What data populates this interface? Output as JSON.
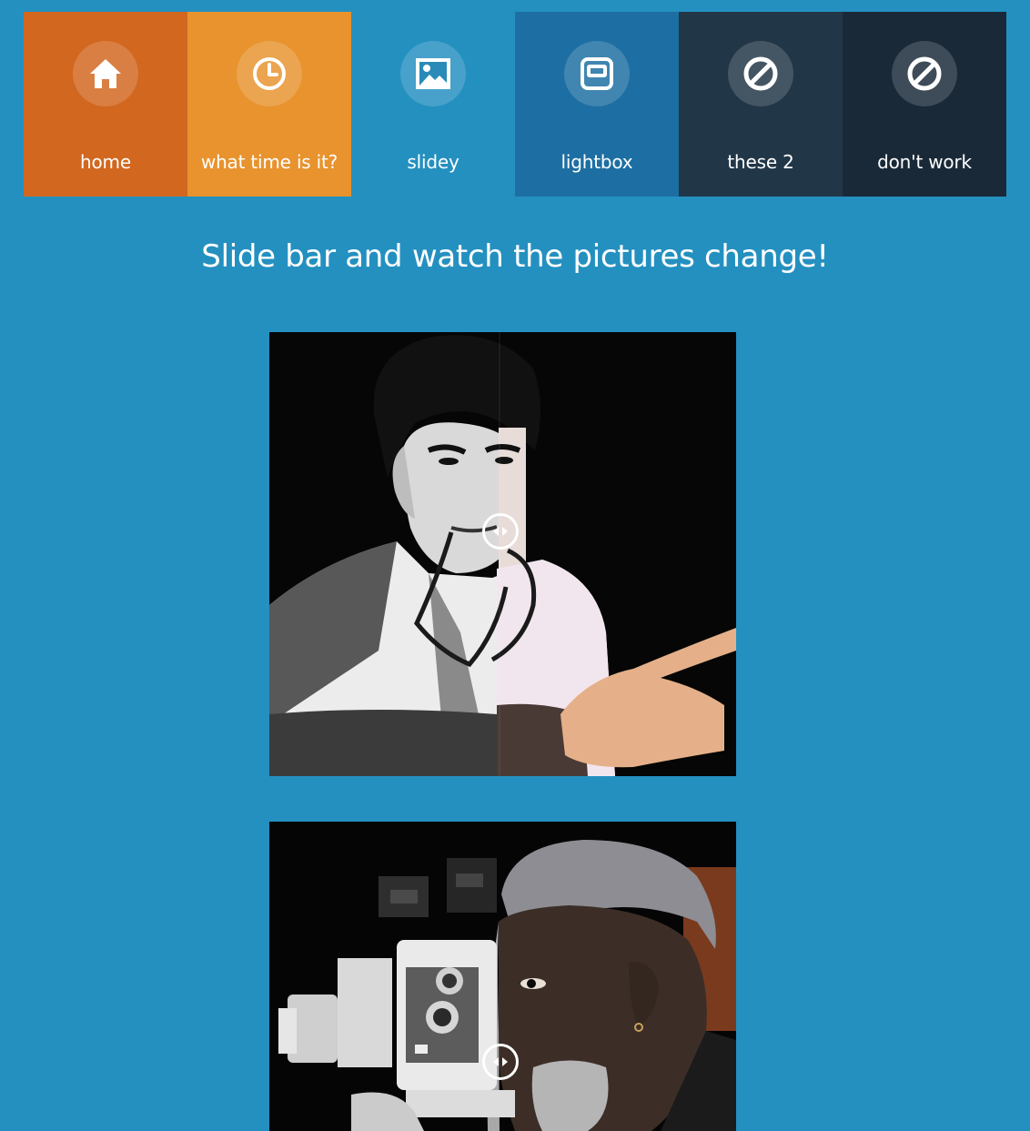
{
  "nav": {
    "items": [
      {
        "label": "home",
        "icon": "home-icon"
      },
      {
        "label": "what time is it?",
        "icon": "clock-icon"
      },
      {
        "label": "slidey",
        "icon": "image-icon"
      },
      {
        "label": "lightbox",
        "icon": "lightbox-icon"
      },
      {
        "label": "these 2",
        "icon": "blocked-icon"
      },
      {
        "label": "don't work",
        "icon": "blocked-icon"
      }
    ]
  },
  "main": {
    "heading": "Slide bar and watch the pictures change!"
  },
  "colors": {
    "background": "#2490c0",
    "home_tile": "#d2671f",
    "time_tile": "#e8932e",
    "lightbox_tile": "#1d6fa3",
    "these_tile": "#213647",
    "dont_tile": "#1a2938"
  }
}
